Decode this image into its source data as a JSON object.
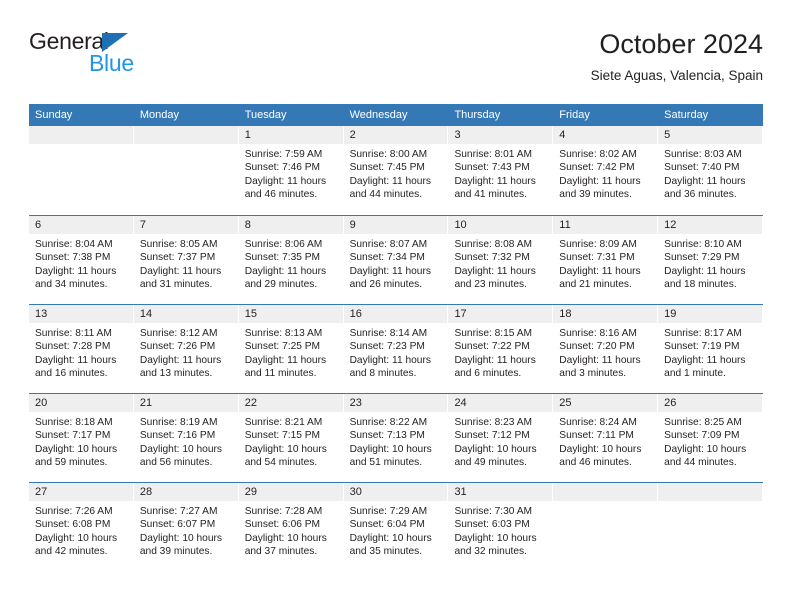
{
  "brand": {
    "name_dark": "General",
    "name_light": "Blue",
    "triangle_color": "#1f6fb4",
    "light_color": "#2196e8"
  },
  "header": {
    "title": "October 2024",
    "subtitle": "Siete Aguas, Valencia, Spain"
  },
  "theme": {
    "header_blue": "#3479b5",
    "day_band_gray": "#efefef",
    "text": "#231f20"
  },
  "weekday_headers": [
    "Sunday",
    "Monday",
    "Tuesday",
    "Wednesday",
    "Thursday",
    "Friday",
    "Saturday"
  ],
  "weeks": [
    [
      {
        "day": "",
        "sunrise": "",
        "sunset": "",
        "daylight_1": "",
        "daylight_2": ""
      },
      {
        "day": "",
        "sunrise": "",
        "sunset": "",
        "daylight_1": "",
        "daylight_2": ""
      },
      {
        "day": "1",
        "sunrise": "Sunrise: 7:59 AM",
        "sunset": "Sunset: 7:46 PM",
        "daylight_1": "Daylight: 11 hours",
        "daylight_2": "and 46 minutes."
      },
      {
        "day": "2",
        "sunrise": "Sunrise: 8:00 AM",
        "sunset": "Sunset: 7:45 PM",
        "daylight_1": "Daylight: 11 hours",
        "daylight_2": "and 44 minutes."
      },
      {
        "day": "3",
        "sunrise": "Sunrise: 8:01 AM",
        "sunset": "Sunset: 7:43 PM",
        "daylight_1": "Daylight: 11 hours",
        "daylight_2": "and 41 minutes."
      },
      {
        "day": "4",
        "sunrise": "Sunrise: 8:02 AM",
        "sunset": "Sunset: 7:42 PM",
        "daylight_1": "Daylight: 11 hours",
        "daylight_2": "and 39 minutes."
      },
      {
        "day": "5",
        "sunrise": "Sunrise: 8:03 AM",
        "sunset": "Sunset: 7:40 PM",
        "daylight_1": "Daylight: 11 hours",
        "daylight_2": "and 36 minutes."
      }
    ],
    [
      {
        "day": "6",
        "sunrise": "Sunrise: 8:04 AM",
        "sunset": "Sunset: 7:38 PM",
        "daylight_1": "Daylight: 11 hours",
        "daylight_2": "and 34 minutes."
      },
      {
        "day": "7",
        "sunrise": "Sunrise: 8:05 AM",
        "sunset": "Sunset: 7:37 PM",
        "daylight_1": "Daylight: 11 hours",
        "daylight_2": "and 31 minutes."
      },
      {
        "day": "8",
        "sunrise": "Sunrise: 8:06 AM",
        "sunset": "Sunset: 7:35 PM",
        "daylight_1": "Daylight: 11 hours",
        "daylight_2": "and 29 minutes."
      },
      {
        "day": "9",
        "sunrise": "Sunrise: 8:07 AM",
        "sunset": "Sunset: 7:34 PM",
        "daylight_1": "Daylight: 11 hours",
        "daylight_2": "and 26 minutes."
      },
      {
        "day": "10",
        "sunrise": "Sunrise: 8:08 AM",
        "sunset": "Sunset: 7:32 PM",
        "daylight_1": "Daylight: 11 hours",
        "daylight_2": "and 23 minutes."
      },
      {
        "day": "11",
        "sunrise": "Sunrise: 8:09 AM",
        "sunset": "Sunset: 7:31 PM",
        "daylight_1": "Daylight: 11 hours",
        "daylight_2": "and 21 minutes."
      },
      {
        "day": "12",
        "sunrise": "Sunrise: 8:10 AM",
        "sunset": "Sunset: 7:29 PM",
        "daylight_1": "Daylight: 11 hours",
        "daylight_2": "and 18 minutes."
      }
    ],
    [
      {
        "day": "13",
        "sunrise": "Sunrise: 8:11 AM",
        "sunset": "Sunset: 7:28 PM",
        "daylight_1": "Daylight: 11 hours",
        "daylight_2": "and 16 minutes."
      },
      {
        "day": "14",
        "sunrise": "Sunrise: 8:12 AM",
        "sunset": "Sunset: 7:26 PM",
        "daylight_1": "Daylight: 11 hours",
        "daylight_2": "and 13 minutes."
      },
      {
        "day": "15",
        "sunrise": "Sunrise: 8:13 AM",
        "sunset": "Sunset: 7:25 PM",
        "daylight_1": "Daylight: 11 hours",
        "daylight_2": "and 11 minutes."
      },
      {
        "day": "16",
        "sunrise": "Sunrise: 8:14 AM",
        "sunset": "Sunset: 7:23 PM",
        "daylight_1": "Daylight: 11 hours",
        "daylight_2": "and 8 minutes."
      },
      {
        "day": "17",
        "sunrise": "Sunrise: 8:15 AM",
        "sunset": "Sunset: 7:22 PM",
        "daylight_1": "Daylight: 11 hours",
        "daylight_2": "and 6 minutes."
      },
      {
        "day": "18",
        "sunrise": "Sunrise: 8:16 AM",
        "sunset": "Sunset: 7:20 PM",
        "daylight_1": "Daylight: 11 hours",
        "daylight_2": "and 3 minutes."
      },
      {
        "day": "19",
        "sunrise": "Sunrise: 8:17 AM",
        "sunset": "Sunset: 7:19 PM",
        "daylight_1": "Daylight: 11 hours",
        "daylight_2": "and 1 minute."
      }
    ],
    [
      {
        "day": "20",
        "sunrise": "Sunrise: 8:18 AM",
        "sunset": "Sunset: 7:17 PM",
        "daylight_1": "Daylight: 10 hours",
        "daylight_2": "and 59 minutes."
      },
      {
        "day": "21",
        "sunrise": "Sunrise: 8:19 AM",
        "sunset": "Sunset: 7:16 PM",
        "daylight_1": "Daylight: 10 hours",
        "daylight_2": "and 56 minutes."
      },
      {
        "day": "22",
        "sunrise": "Sunrise: 8:21 AM",
        "sunset": "Sunset: 7:15 PM",
        "daylight_1": "Daylight: 10 hours",
        "daylight_2": "and 54 minutes."
      },
      {
        "day": "23",
        "sunrise": "Sunrise: 8:22 AM",
        "sunset": "Sunset: 7:13 PM",
        "daylight_1": "Daylight: 10 hours",
        "daylight_2": "and 51 minutes."
      },
      {
        "day": "24",
        "sunrise": "Sunrise: 8:23 AM",
        "sunset": "Sunset: 7:12 PM",
        "daylight_1": "Daylight: 10 hours",
        "daylight_2": "and 49 minutes."
      },
      {
        "day": "25",
        "sunrise": "Sunrise: 8:24 AM",
        "sunset": "Sunset: 7:11 PM",
        "daylight_1": "Daylight: 10 hours",
        "daylight_2": "and 46 minutes."
      },
      {
        "day": "26",
        "sunrise": "Sunrise: 8:25 AM",
        "sunset": "Sunset: 7:09 PM",
        "daylight_1": "Daylight: 10 hours",
        "daylight_2": "and 44 minutes."
      }
    ],
    [
      {
        "day": "27",
        "sunrise": "Sunrise: 7:26 AM",
        "sunset": "Sunset: 6:08 PM",
        "daylight_1": "Daylight: 10 hours",
        "daylight_2": "and 42 minutes."
      },
      {
        "day": "28",
        "sunrise": "Sunrise: 7:27 AM",
        "sunset": "Sunset: 6:07 PM",
        "daylight_1": "Daylight: 10 hours",
        "daylight_2": "and 39 minutes."
      },
      {
        "day": "29",
        "sunrise": "Sunrise: 7:28 AM",
        "sunset": "Sunset: 6:06 PM",
        "daylight_1": "Daylight: 10 hours",
        "daylight_2": "and 37 minutes."
      },
      {
        "day": "30",
        "sunrise": "Sunrise: 7:29 AM",
        "sunset": "Sunset: 6:04 PM",
        "daylight_1": "Daylight: 10 hours",
        "daylight_2": "and 35 minutes."
      },
      {
        "day": "31",
        "sunrise": "Sunrise: 7:30 AM",
        "sunset": "Sunset: 6:03 PM",
        "daylight_1": "Daylight: 10 hours",
        "daylight_2": "and 32 minutes."
      },
      {
        "day": "",
        "sunrise": "",
        "sunset": "",
        "daylight_1": "",
        "daylight_2": ""
      },
      {
        "day": "",
        "sunrise": "",
        "sunset": "",
        "daylight_1": "",
        "daylight_2": ""
      }
    ]
  ]
}
